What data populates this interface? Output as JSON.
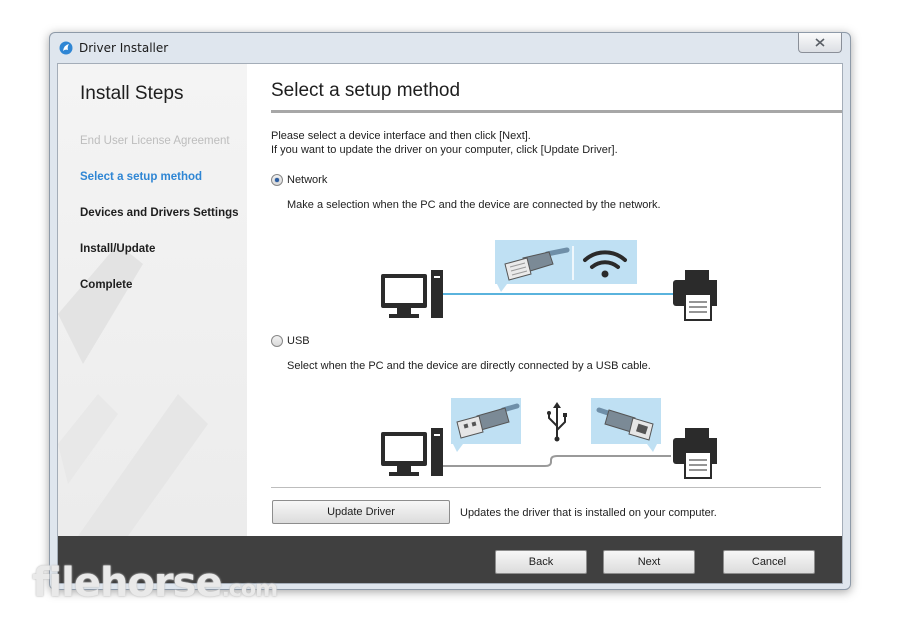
{
  "window": {
    "title": "Driver Installer"
  },
  "sidebar": {
    "heading": "Install Steps",
    "steps": [
      {
        "label": "End User License Agreement",
        "state": "done"
      },
      {
        "label": "Select a setup method",
        "state": "current"
      },
      {
        "label": "Devices and Drivers Settings",
        "state": "pending"
      },
      {
        "label": "Install/Update",
        "state": "pending"
      },
      {
        "label": "Complete",
        "state": "pending"
      }
    ]
  },
  "main": {
    "title": "Select a setup method",
    "instructions": [
      "Please select a device interface and then click [Next].",
      "If you want to update the driver on your computer, click [Update Driver]."
    ],
    "options": [
      {
        "label": "Network",
        "description": "Make a selection when the PC and the device are connected by the network.",
        "checked": true
      },
      {
        "label": "USB",
        "description": "Select when the PC and the device are directly connected by a USB cable.",
        "checked": false
      }
    ],
    "update_button": "Update Driver",
    "update_note": "Updates the driver that is installed on your computer."
  },
  "footer": {
    "back": "Back",
    "next": "Next",
    "cancel": "Cancel"
  },
  "watermark": {
    "main": "filehorse",
    "suffix": ".com"
  },
  "colors": {
    "accent": "#2f86d4",
    "network_line": "#5ab3dd",
    "bubble": "#bfe0f3",
    "footer": "#404040"
  }
}
